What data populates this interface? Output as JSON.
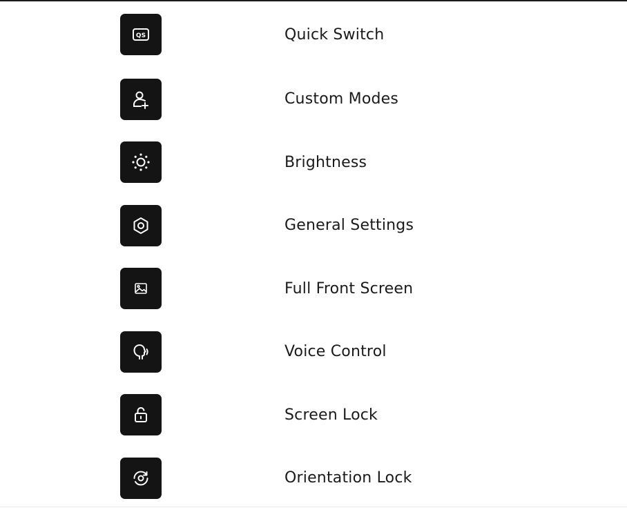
{
  "features": [
    {
      "label": "Quick Switch",
      "icon": "quick-switch-icon",
      "badge": "QS"
    },
    {
      "label": "Custom Modes",
      "icon": "person-add-icon"
    },
    {
      "label": "Brightness",
      "icon": "brightness-icon"
    },
    {
      "label": "General Settings",
      "icon": "settings-hexagon-icon"
    },
    {
      "label": "Full Front Screen",
      "icon": "image-icon"
    },
    {
      "label": "Voice Control",
      "icon": "voice-control-icon"
    },
    {
      "label": "Screen Lock",
      "icon": "lock-icon"
    },
    {
      "label": "Orientation Lock",
      "icon": "rotation-lock-icon"
    }
  ],
  "colors": {
    "tile": "#141414",
    "icon": "#ffffff",
    "text": "#1a1a1a"
  }
}
